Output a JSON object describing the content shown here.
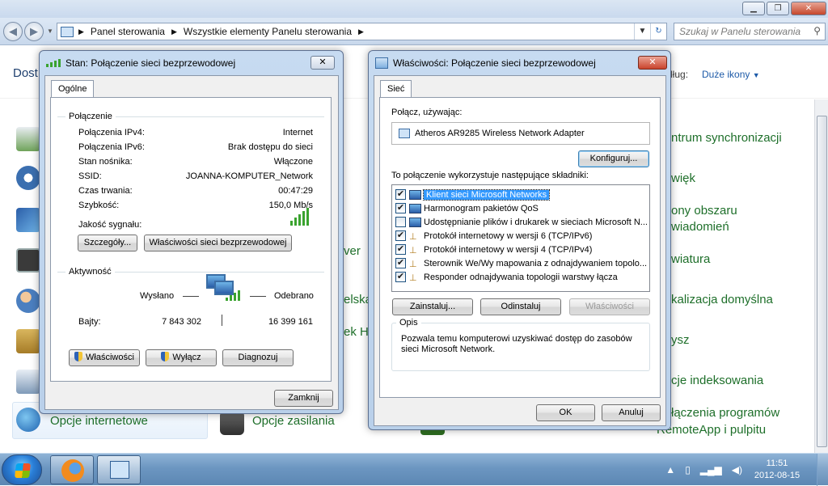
{
  "explorer": {
    "breadcrumb": [
      "Panel sterowania",
      "Wszystkie elementy Panelu sterowania"
    ],
    "search_placeholder": "Szukaj w Panelu sterowania",
    "view_partial_left": "Dost",
    "view_label": "dług:",
    "view_value": "Duże ikony",
    "items_right": [
      "ntrum synchronizacji",
      "więk",
      "ony obszaru",
      "wiadomień",
      "wiatura",
      "kalizacja domyślna",
      "ysz",
      "cje indeksowania",
      "łączenia programów",
      "RemoteApp i pulpitu"
    ],
    "items_middle": [
      "ver",
      "elska",
      "ek HI"
    ],
    "items_bottom": [
      "Opcje internetowe",
      "Opcje zasilania"
    ]
  },
  "status_dialog": {
    "title": "Stan: Połączenie sieci bezprzewodowej",
    "tab": "Ogólne",
    "connection_group": "Połączenie",
    "rows": [
      {
        "label": "Połączenia IPv4:",
        "value": "Internet"
      },
      {
        "label": "Połączenia IPv6:",
        "value": "Brak dostępu do sieci"
      },
      {
        "label": "Stan nośnika:",
        "value": "Włączone"
      },
      {
        "label": "SSID:",
        "value": "JOANNA-KOMPUTER_Network"
      },
      {
        "label": "Czas trwania:",
        "value": "00:47:29"
      },
      {
        "label": "Szybkość:",
        "value": "150,0 Mb/s"
      }
    ],
    "signal_label": "Jakość sygnału:",
    "signal_bars_lit": 5,
    "signal_bars_total": 5,
    "details_button": "Szczegóły...",
    "wireless_props_button": "Właściwości sieci bezprzewodowej",
    "activity_group": "Aktywność",
    "sent_label": "Wysłano",
    "received_label": "Odebrano",
    "bytes_label": "Bajty:",
    "bytes_sent": "7 843 302",
    "bytes_received": "16 399 161",
    "properties_button": "Właściwości",
    "disable_button": "Wyłącz",
    "diagnose_button": "Diagnozuj",
    "close_button": "Zamknij"
  },
  "props_dialog": {
    "title": "Właściwości: Połączenie sieci bezprzewodowej",
    "tab": "Sieć",
    "connect_using_label": "Połącz, używając:",
    "adapter_name": "Atheros AR9285 Wireless Network Adapter",
    "configure_button": "Konfiguruj...",
    "components_label": "To połączenie wykorzystuje następujące składniki:",
    "components": [
      {
        "name": "Klient sieci Microsoft Networks",
        "checked": true,
        "selected": true
      },
      {
        "name": "Harmonogram pakietów QoS",
        "checked": true,
        "selected": false
      },
      {
        "name": "Udostępnianie plików i drukarek w sieciach Microsoft N...",
        "checked": false,
        "selected": false
      },
      {
        "name": "Protokół internetowy w wersji 6 (TCP/IPv6)",
        "checked": true,
        "selected": false
      },
      {
        "name": "Protokół internetowy w wersji 4 (TCP/IPv4)",
        "checked": true,
        "selected": false
      },
      {
        "name": "Sterownik We/Wy mapowania z odnajdywaniem topolo...",
        "checked": true,
        "selected": false
      },
      {
        "name": "Responder odnajdywania topologii warstwy łącza",
        "checked": true,
        "selected": false
      }
    ],
    "install_button": "Zainstaluj...",
    "uninstall_button": "Odinstaluj",
    "properties_button": "Właściwości",
    "description_group": "Opis",
    "description": "Pozwala temu komputerowi uzyskiwać dostęp do zasobów sieci Microsoft Network.",
    "ok_button": "OK",
    "cancel_button": "Anuluj"
  },
  "taskbar": {
    "time": "11:51",
    "date": "2012-08-15"
  },
  "colors": {
    "accent_link": "#1d5aa8",
    "cp_item_green": "#1e6f2a",
    "selection": "#3399ff",
    "signal_green": "#3aa32f"
  }
}
